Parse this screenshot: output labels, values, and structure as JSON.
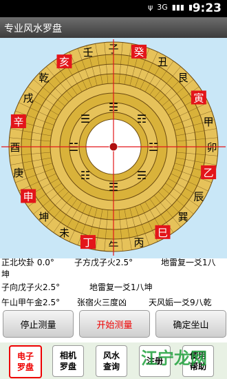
{
  "statusbar": {
    "time": "9:23",
    "network": "3G"
  },
  "title": "专业风水罗盘",
  "readings": {
    "line1_a": "正北坎卦  0.0°",
    "line1_b": "子方戊子火2.5°",
    "line1_c": "地雷复一爻1八",
    "line2": "坤",
    "line3_a": "子向戊子火2.5°",
    "line3_b": "地雷复一爻1八坤",
    "line4_a": "午山甲午金2.5°",
    "line4_b": "张宿火三度凶",
    "line4_c": "天风姤一爻9八乾"
  },
  "buttons": {
    "stop": "停止测量",
    "start": "开始测量",
    "confirm": "确定坐山"
  },
  "tabs": [
    {
      "line1": "电子",
      "line2": "罗盘"
    },
    {
      "line1": "相机",
      "line2": "罗盘"
    },
    {
      "line1": "风水",
      "line2": "查询"
    },
    {
      "line1": "注册",
      "line2": ""
    },
    {
      "line1": "使用",
      "line2": "帮助"
    }
  ],
  "watermark": "江宁龙网",
  "compass": {
    "mountains": [
      "子",
      "癸",
      "丑",
      "艮",
      "寅",
      "甲",
      "卯",
      "乙",
      "辰",
      "巽",
      "巳",
      "丙",
      "午",
      "丁",
      "未",
      "坤",
      "申",
      "庚",
      "酉",
      "辛",
      "戌",
      "乾",
      "亥",
      "壬"
    ],
    "trigrams": [
      "☵",
      "☶",
      "☳",
      "☴",
      "☲",
      "☷",
      "☱",
      "☰"
    ],
    "colors": {
      "red": "#e3151a",
      "gold": "#d9b23a",
      "dark_gold": "#b8861a",
      "sky": "#c9e7f7"
    }
  }
}
